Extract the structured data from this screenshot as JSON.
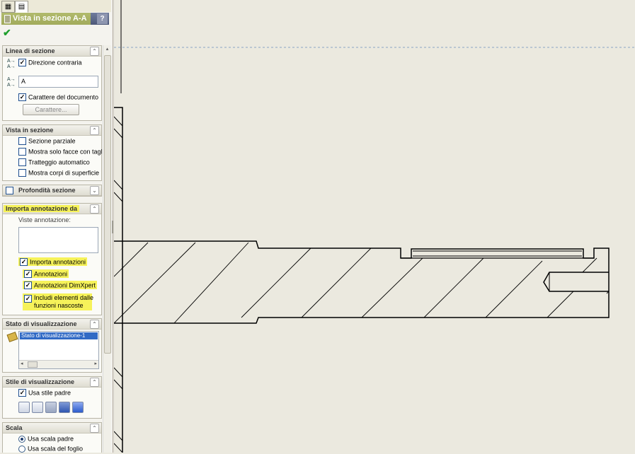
{
  "panel": {
    "title": "Vista in sezione A-A",
    "help": "?",
    "ok_symbol": "✔",
    "groups": {
      "linea": {
        "title": "Linea di sezione",
        "direzione_contraria": "Direzione contraria",
        "label_value": "A",
        "carattere_documento": "Carattere del documento",
        "carattere_button": "Carattere..."
      },
      "vista": {
        "title": "Vista in sezione",
        "options": [
          "Sezione parziale",
          "Mostra solo facce con taglio",
          "Tratteggio automatico",
          "Mostra corpi di superficie"
        ]
      },
      "profondita": {
        "title": "Profondità sezione"
      },
      "importa": {
        "title": "Importa annotazione da",
        "viste_label": "Viste annotazione:",
        "importa_annotazioni": "Importa annotazioni",
        "annotazioni": "Annotazioni",
        "dimxpert": "Annotazioni DimXpert",
        "includi_1": "Includi elementi dalle",
        "includi_2": "funzioni nascoste"
      },
      "stato": {
        "title": "Stato di visualizzazione",
        "item": "Stato di visualizzazione-1"
      },
      "stile": {
        "title": "Stile di visualizzazione",
        "usa_stile_padre": "Usa stile padre",
        "styles": [
          "wireframe-icon",
          "hidden-lines-visible-icon",
          "hidden-lines-removed-icon",
          "shaded-with-edges-icon",
          "shaded-icon"
        ]
      },
      "scala": {
        "title": "Scala",
        "usa_scala_padre": "Usa scala padre",
        "usa_scala_foglio": "Usa scala del foglio"
      }
    }
  },
  "colors": {
    "highlight": "#f6f25a",
    "canvas": "#ebe9df",
    "ok": "#1e9e2c"
  }
}
